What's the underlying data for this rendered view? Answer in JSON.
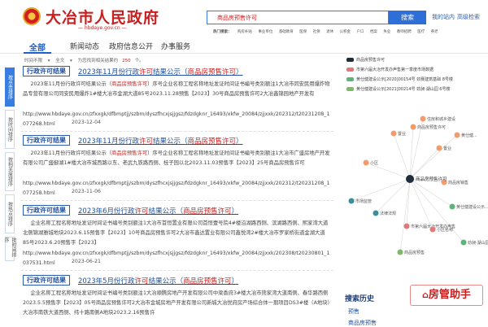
{
  "header": {
    "site_title": "大冶市人民政府",
    "site_domain": "— hbdaye.gov.cn —",
    "search_value": "商品房预售许可",
    "search_button": "搜索",
    "top_links": [
      "我的站内",
      "高级检索"
    ],
    "hot_label": "热门搜索：",
    "hot_terms": [
      "购房补贴",
      "事业单位",
      "基础教育",
      "医保",
      "社保",
      "退休",
      "公积金",
      "户口",
      "档案",
      "失业",
      "教师招聘",
      "医疗",
      "养老"
    ]
  },
  "nav": {
    "items": [
      "全部",
      "新闻动态",
      "政府信息公开",
      "办事服务"
    ],
    "active_index": 0
  },
  "filter": {
    "time_label": "时间不限",
    "scope_label": "全文",
    "count_prefix": "为您找到相关结果约",
    "count": "250",
    "count_suffix": "个。"
  },
  "side_tabs": [
    "按点击排序",
    "按时间排序",
    "按相关度排序",
    "按热点排序",
    "按时间排序"
  ],
  "results": [
    {
      "tag": "行政许可结果",
      "title_pre": "2023年11月份行政",
      "title_hl": "许可",
      "title_mid": "结果公示（",
      "title_hl2": "商品房预售许可",
      "title_post": "）",
      "body_pre": "2023年11月份行政许可结果公示（",
      "body_hl": "商品房预售许可",
      "body_post": "）序号企业名称工程名称地址发证时间证书编号类别额注1大冶市同安民用爆炸物品专营有限公司同安民用爆炸1#楼大冶市金湖大道85号2023.11.28预售【2023】30号商品房预售许可2大冶鑫锦园地产开发有",
      "url": "http://www.hbdaye.gov.cn/zfxxgk/dfbmptjj/szbm/dyszfhcxjsjjgsz/fdzdgknr_16493/xkfw_20084/zjjxxk/202312/t20231208_1077268.html",
      "date": "2023-12-04"
    },
    {
      "tag": "行政许可结果",
      "title_pre": "2023年11月份行政",
      "title_hl": "许可",
      "title_mid": "结果公示（",
      "title_hl2": "商品房预售许可",
      "title_post": "）",
      "body_pre": "2023年11月份行政许可结果公示（",
      "body_hl": "商品房预售许可",
      "body_post": "）序号企业名称工程名称地址发证时间证书编号类别额注1大冶市广盛房地产开发有限公司广盛御湖1#楼大冶市城西路以东、老武九铁路西侧、桂子园以北2023.11.03预售字【2023】25号商品房预售许可",
      "url": "http://www.hbdaye.gov.cn/zfxxgk/dfbmptjj/szbm/dyszfhcxjsjjgsz/fdzdgknr_16493/xkfw_20084/zjjxxk/202312/t20231208_1077258.html",
      "date": "2023-11-06"
    },
    {
      "tag": "行政许可结果",
      "title_pre": "2023年6月份行政",
      "title_hl": "许可",
      "title_mid": "结果公示（",
      "title_hl2": "商品房预售许可",
      "title_post": "）",
      "body_pre": "企业名称工程名称地址发证时间证书编号类别额注1大冶市首恒置业有限公司首恒壹号院4#楼沿湖路西侧、滨湖路西侧、熙家湾大道北侧锦湖雅城地块2023.6.15预售字【2023】10号商品房预售许可2大冶市鑫达置业有限公司鑫悦湾2#楼大冶市罗家桥街道金湖大道85号2023.6.20预售字【2023】",
      "body_hl": "",
      "body_post": "",
      "url": "http://www.hbdaye.gov.cn/zfxxgk/dfbmptjj/szbm/dyszfhcxjsjjgsz/fdzdgknr_16493/xkfw_20084/zjjxxk/202308/t20230801_1037531.html",
      "date": "2023-06-21"
    },
    {
      "tag": "行政许可结果",
      "title_pre": "2023年5月份行政",
      "title_hl": "许可",
      "title_mid": "结果公示（",
      "title_hl2": "商品房预售许可",
      "title_post": "）",
      "body_pre": "企业名称工程名称地址发证时间证书编号类别额注1大冶顺腾房地产开发有限公司中梁香府3#楼大冶市熊家湾大道南侧、春华路西侧2023.5.5预售字【2023】05号商品房预售许可2大冶市金城房地产开发有限公司新城大冶悦府房产场综合体一期项目DS3#楼（A地块）大冶市南铁大道西侧、纬十路南侧A地块2023.2.16预售许",
      "body_hl": "",
      "body_post": "",
      "url": "",
      "date": ""
    }
  ],
  "right_panel": {
    "legend": [
      {
        "label": "商品房预售许可",
        "color": "#1f2d3d"
      },
      {
        "label": "市第六届大冶开发办声售第一季度市场数据",
        "color": "#e07a7a"
      },
      {
        "label": "黄仕健建设公示[2020]00154号 劲赛建筑基础 8号楼",
        "color": "#5db37a"
      },
      {
        "label": "黄仕健建设公示[2021]00214号 劲昶·湖山园 6号楼",
        "color": "#7fb86a"
      }
    ],
    "graph": {
      "center": "商品房预售许可",
      "nodes": [
        {
          "label": "置业",
          "color": "#f29b6b"
        },
        {
          "label": "住房和城乡建设",
          "color": "#f29b6b"
        },
        {
          "label": "黄仕健...",
          "color": "#f29b6b"
        },
        {
          "label": "置业",
          "color": "#f29b6b"
        },
        {
          "label": "商品房预售许可",
          "color": "#f29b6b"
        },
        {
          "label": "小区",
          "color": "#f29b6b"
        },
        {
          "label": "商品房销售",
          "color": "#f29b6b"
        },
        {
          "label": "市场监管",
          "color": "#3a8f9a"
        },
        {
          "label": "法律法规",
          "color": "#3a8f9a"
        },
        {
          "label": "市第六届大冶开发办声售",
          "color": "#e07a7a"
        },
        {
          "label": "小区名称",
          "color": "#e07a7a"
        },
        {
          "label": "黄仕健建设公示...",
          "color": "#5db37a"
        },
        {
          "label": "劲昶·湖山园",
          "color": "#5db37a"
        },
        {
          "label": "商品房预售",
          "color": "#7fb86a"
        }
      ]
    }
  },
  "history": {
    "title": "搜索历史",
    "items": [
      "预售",
      "商品房预售"
    ]
  },
  "assistant": {
    "label": "房管助手"
  }
}
